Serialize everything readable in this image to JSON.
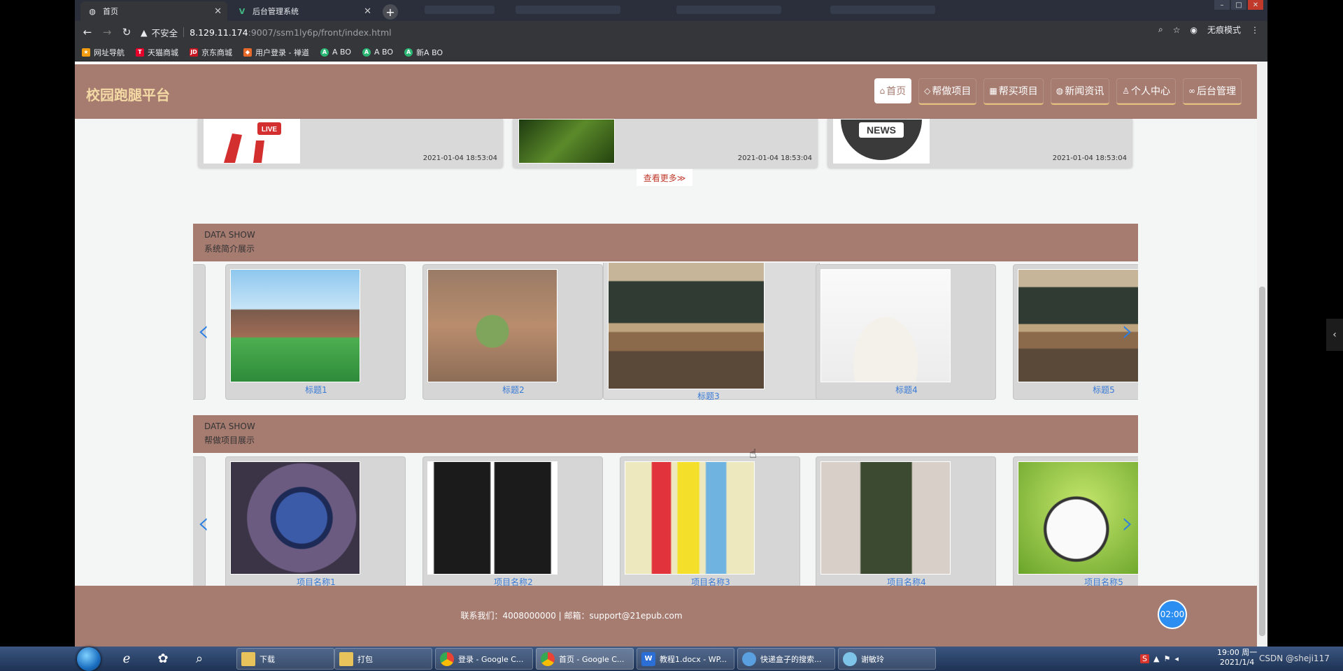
{
  "browser": {
    "tabs": [
      {
        "title": "首页",
        "icon": "globe-icon"
      },
      {
        "title": "后台管理系统",
        "icon": "vue-icon"
      }
    ],
    "url_warning": "不安全",
    "url_host": "8.129.11.174",
    "url_rest": ":9007/ssm1ly6p/front/index.html",
    "profile_label": "无痕模式",
    "bookmarks": [
      "网址导航",
      "天猫商城",
      "京东商城",
      "用户登录 - 禅道",
      "A BO",
      "A BO",
      "新A BO"
    ]
  },
  "site": {
    "title": "校园跑腿平台",
    "nav": [
      {
        "label": "首页",
        "icon": "home-icon"
      },
      {
        "label": "帮做项目",
        "icon": "tag-icon"
      },
      {
        "label": "帮买项目",
        "icon": "grid-icon"
      },
      {
        "label": "新闻资讯",
        "icon": "globe-icon"
      },
      {
        "label": "个人中心",
        "icon": "user-icon"
      },
      {
        "label": "后台管理",
        "icon": "link-icon"
      }
    ]
  },
  "news": {
    "items": [
      {
        "date": "2021-01-04 18:53:04",
        "badge": "LIVE"
      },
      {
        "date": "2021-01-04 18:53:04"
      },
      {
        "date": "2021-01-04 18:53:04",
        "badge": "NEWS"
      }
    ],
    "more_label": "查看更多≫"
  },
  "section_intro": {
    "heading_en": "DATA SHOW",
    "heading_cn": "系统简介展示",
    "slides": [
      "标题1",
      "标题2",
      "标题3",
      "标题4",
      "标题5"
    ]
  },
  "section_projects": {
    "heading_en": "DATA SHOW",
    "heading_cn": "帮做项目展示",
    "slides": [
      "项目名称1",
      "项目名称2",
      "项目名称3",
      "项目名称4",
      "项目名称5"
    ]
  },
  "footer": {
    "text": "联系我们：4008000000 | 邮箱：support@21epub.com"
  },
  "timer": "02:00",
  "taskbar": {
    "buttons": [
      "下载",
      "打包",
      "登录 - Google C...",
      "首页 - Google C...",
      "教程1.docx - WP...",
      "快递盒子的搜索...",
      "谢敏玲"
    ],
    "clock_time": "19:00 周一",
    "clock_date": "2021/1/4"
  },
  "watermark": "CSDN @sheji117",
  "colors": {
    "brand": "#a67b70",
    "accent": "#e7c27a",
    "link": "#3a7bd5"
  }
}
